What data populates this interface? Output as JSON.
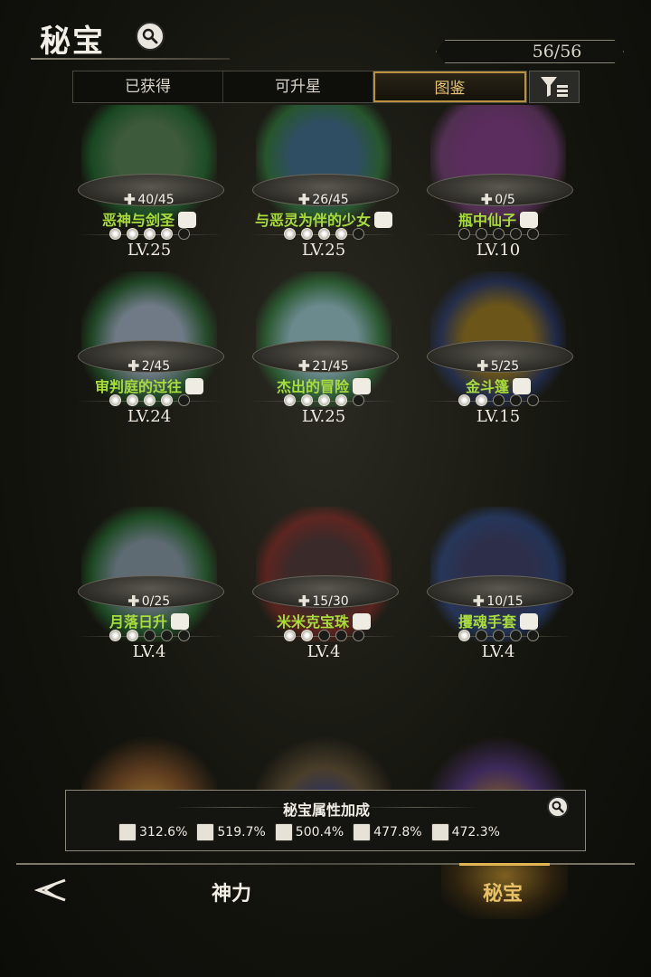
{
  "header": {
    "title": "秘宝",
    "counter": "56/56"
  },
  "tabs": [
    {
      "label": "已获得",
      "active": false
    },
    {
      "label": "可升星",
      "active": false
    },
    {
      "label": "图鉴",
      "active": true
    }
  ],
  "items": [
    {
      "name": "恶神与剑圣",
      "shards": "40/45",
      "level": "LV.25",
      "stars": 4,
      "icon": "fist-icon",
      "art": "demon-swordsman-art"
    },
    {
      "name": "与恶灵为伴的少女",
      "shards": "26/45",
      "level": "LV.25",
      "stars": 4,
      "icon": "fist-icon",
      "art": "spirit-girl-art"
    },
    {
      "name": "瓶中仙子",
      "shards": "0/5",
      "level": "LV.10",
      "stars": 0,
      "icon": "swirl-icon",
      "art": "fairy-bottle-art"
    },
    {
      "name": "审判庭的过往",
      "shards": "2/45",
      "level": "LV.24",
      "stars": 4,
      "icon": "fist-icon",
      "art": "castle-shards-art"
    },
    {
      "name": "杰出的冒险",
      "shards": "21/45",
      "level": "LV.25",
      "stars": 4,
      "icon": "boot-icon",
      "art": "adventurer-art"
    },
    {
      "name": "金斗篷",
      "shards": "5/25",
      "level": "LV.15",
      "stars": 2,
      "icon": "boot-icon",
      "art": "golden-cloak-art"
    },
    {
      "name": "月落日升",
      "shards": "0/25",
      "level": "LV.4",
      "stars": 2,
      "icon": "boot-icon",
      "art": "moonfall-art"
    },
    {
      "name": "米米克宝珠",
      "shards": "15/30",
      "level": "LV.4",
      "stars": 2,
      "icon": "fist-icon",
      "art": "mimic-orb-art"
    },
    {
      "name": "攫魂手套",
      "shards": "10/15",
      "level": "LV.4",
      "stars": 1,
      "icon": "swirl-icon",
      "art": "soul-gauntlet-art"
    }
  ],
  "partial_row": [
    {
      "art": "candle-art"
    },
    {
      "art": "lamp-art"
    },
    {
      "art": "dragon-eye-art"
    }
  ],
  "bonus": {
    "title": "秘宝属性加成",
    "stats": [
      {
        "icon": "sword-icon",
        "value": "312.6%"
      },
      {
        "icon": "fist-icon",
        "value": "519.7%"
      },
      {
        "icon": "swirl-icon",
        "value": "500.4%"
      },
      {
        "icon": "boot-icon",
        "value": "477.8%"
      },
      {
        "icon": "hand-icon",
        "value": "472.3%"
      }
    ]
  },
  "nav": {
    "left": "神力",
    "right": "秘宝",
    "active": "秘宝"
  },
  "colors": {
    "name_green": "#a8dc3c",
    "tab_gold": "#e8c56b",
    "nav_gold": "#e2b454"
  }
}
